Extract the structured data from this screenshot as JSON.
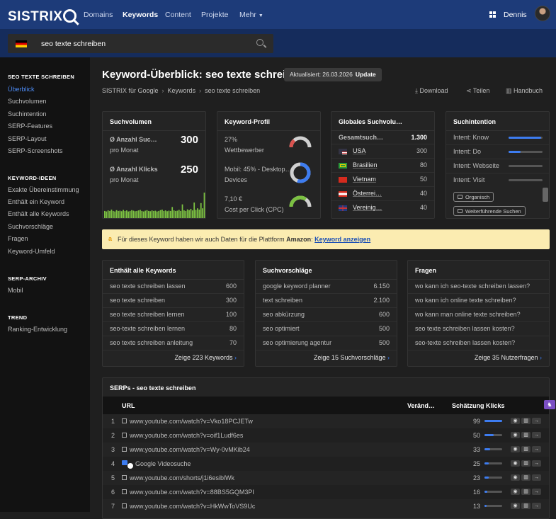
{
  "header": {
    "logo": "SISTRIX",
    "nav": [
      "Domains",
      "Keywords",
      "Content",
      "Projekte",
      "Mehr"
    ],
    "user": "Dennis"
  },
  "search": {
    "value": "seo texte schreiben"
  },
  "sidebar": {
    "section1": "SEO TEXTE SCHREIBEN",
    "items1": [
      "Überblick",
      "Suchvolumen",
      "Suchintention",
      "SERP-Features",
      "SERP-Layout",
      "SERP-Screenshots"
    ],
    "section2": "KEYWORD-IDEEN",
    "items2": [
      "Exakte Übereinstimmung",
      "Enthält ein Keyword",
      "Enthält alle Keywords",
      "Suchvorschläge",
      "Fragen",
      "Keyword-Umfeld"
    ],
    "section3": "SERP-ARCHIV",
    "items3": [
      "Mobil"
    ],
    "section4": "TREND",
    "items4": [
      "Ranking-Entwicklung"
    ]
  },
  "page": {
    "title": "Keyword-Überblick: seo texte schreiben",
    "updated_label": "Aktualisiert: 26.03.2026",
    "update_button": "Update",
    "breadcrumbs": [
      "SISTRIX für Google",
      "Keywords",
      "seo texte schreiben"
    ],
    "actions": [
      "Download",
      "Teilen",
      "Handbuch"
    ]
  },
  "suchvolumen": {
    "title": "Suchvolumen",
    "searches_label": "Ø Anzahl Suc…",
    "searches_sub": "pro Monat",
    "searches_value": "300",
    "clicks_label": "Ø Anzahl Klicks",
    "clicks_sub": "pro Monat",
    "clicks_value": "250",
    "trend": [
      0.3,
      0.28,
      0.32,
      0.3,
      0.35,
      0.3,
      0.28,
      0.33,
      0.3,
      0.31,
      0.29,
      0.34,
      0.3,
      0.32,
      0.28,
      0.3,
      0.33,
      0.31,
      0.29,
      0.3,
      0.32,
      0.34,
      0.3,
      0.28,
      0.31,
      0.33,
      0.3,
      0.29,
      0.32,
      0.3,
      0.31,
      0.28,
      0.3,
      0.33,
      0.35,
      0.3,
      0.32,
      0.29,
      0.31,
      0.3,
      0.45,
      0.32,
      0.3,
      0.31,
      0.34,
      0.3,
      0.55,
      0.32,
      0.3,
      0.36,
      0.33,
      0.38,
      0.32,
      0.62,
      0.34,
      0.4,
      0.35,
      0.6,
      0.4,
      1.0
    ]
  },
  "keyword_profil": {
    "title": "Keyword-Profil",
    "competition_value": "27%",
    "competition_label": "Wettbewerber",
    "competition_pct": 27,
    "devices_value": "Mobil: 45% - Desktop…",
    "devices_label": "Devices",
    "mobile_pct": 45,
    "cpc_value": "7,10 €",
    "cpc_label": "Cost per Click (CPC)",
    "cpc_pct": 70,
    "colors": {
      "red": "#d9534f",
      "blue": "#3d7cf0",
      "green": "#7cc142",
      "track": "#d0d0d0"
    }
  },
  "global_volume": {
    "title": "Globales Suchvolu…",
    "total_label": "Gesamtsuch…",
    "total_value": "1.300",
    "countries": [
      {
        "name": "USA",
        "value": "300",
        "flag": "us"
      },
      {
        "name": "Brasilien",
        "value": "80",
        "flag": "br"
      },
      {
        "name": "Vietnam",
        "value": "50",
        "flag": "vn"
      },
      {
        "name": "Österrei…",
        "value": "40",
        "flag": "at"
      },
      {
        "name": "Vereinig…",
        "value": "40",
        "flag": "gb"
      }
    ]
  },
  "intent": {
    "title": "Suchintention",
    "items": [
      {
        "label": "Intent: Know",
        "level": 0.95
      },
      {
        "label": "Intent: Do",
        "level": 0.35
      },
      {
        "label": "Intent: Webseite",
        "level": 0.0
      },
      {
        "label": "Intent: Visit",
        "level": 0.0
      }
    ],
    "tags": [
      "Organisch",
      "Weiterführende Suchen"
    ]
  },
  "amazon": {
    "text_before": "Für dieses Keyword haben wir auch Daten für die Plattform ",
    "platform": "Amazon",
    "text_after": ": ",
    "link": "Keyword anzeigen"
  },
  "contains_all": {
    "title": "Enthält alle Keywords",
    "rows": [
      {
        "kw": "seo texte schreiben lassen",
        "v": "600"
      },
      {
        "kw": "seo texte schreiben",
        "v": "300"
      },
      {
        "kw": "seo texte schreiben lernen",
        "v": "100"
      },
      {
        "kw": "seo-texte schreiben lernen",
        "v": "80"
      },
      {
        "kw": "seo texte schreiben anleitung",
        "v": "70"
      }
    ],
    "show": "Zeige 223 Keywords"
  },
  "suggestions": {
    "title": "Suchvorschläge",
    "rows": [
      {
        "kw": "google keyword planner",
        "v": "6.150"
      },
      {
        "kw": "text schreiben",
        "v": "2.100"
      },
      {
        "kw": "seo abkürzung",
        "v": "600"
      },
      {
        "kw": "seo optimiert",
        "v": "500"
      },
      {
        "kw": "seo optimierung agentur",
        "v": "500"
      }
    ],
    "show": "Zeige 15 Suchvorschläge"
  },
  "questions": {
    "title": "Fragen",
    "rows": [
      "wo kann ich seo-texte schreiben lassen?",
      "wo kann ich online texte schreiben?",
      "wo kann man online texte schreiben?",
      "seo texte schreiben lassen kosten?",
      "seo-texte schreiben lassen kosten?"
    ],
    "show": "Zeige 35 Nutzerfragen"
  },
  "serps": {
    "title": "SERPs - seo texte schreiben",
    "col_url": "URL",
    "col_change": "Veränd…",
    "col_clicks": "Schätzung Klicks",
    "rows": [
      {
        "pos": "1",
        "url": "www.youtube.com/watch?v=Vko18PCJETw",
        "clicks": "99",
        "share": 0.99
      },
      {
        "pos": "2",
        "url": "www.youtube.com/watch?v=oif1Ludf6es",
        "clicks": "50",
        "share": 0.5
      },
      {
        "pos": "3",
        "url": "www.youtube.com/watch?v=Wy-0vMKib24",
        "clicks": "33",
        "share": 0.33
      },
      {
        "pos": "4",
        "url": "Google Videosuche",
        "clicks": "25",
        "share": 0.25,
        "special": true
      },
      {
        "pos": "5",
        "url": "www.youtube.com/shorts/j1i6esiblWk",
        "clicks": "23",
        "share": 0.23
      },
      {
        "pos": "6",
        "url": "www.youtube.com/watch?v=88BS5GQM3PI",
        "clicks": "16",
        "share": 0.16
      },
      {
        "pos": "7",
        "url": "www.youtube.com/watch?v=HkWwToVS9Uc",
        "clicks": "13",
        "share": 0.13
      }
    ]
  }
}
